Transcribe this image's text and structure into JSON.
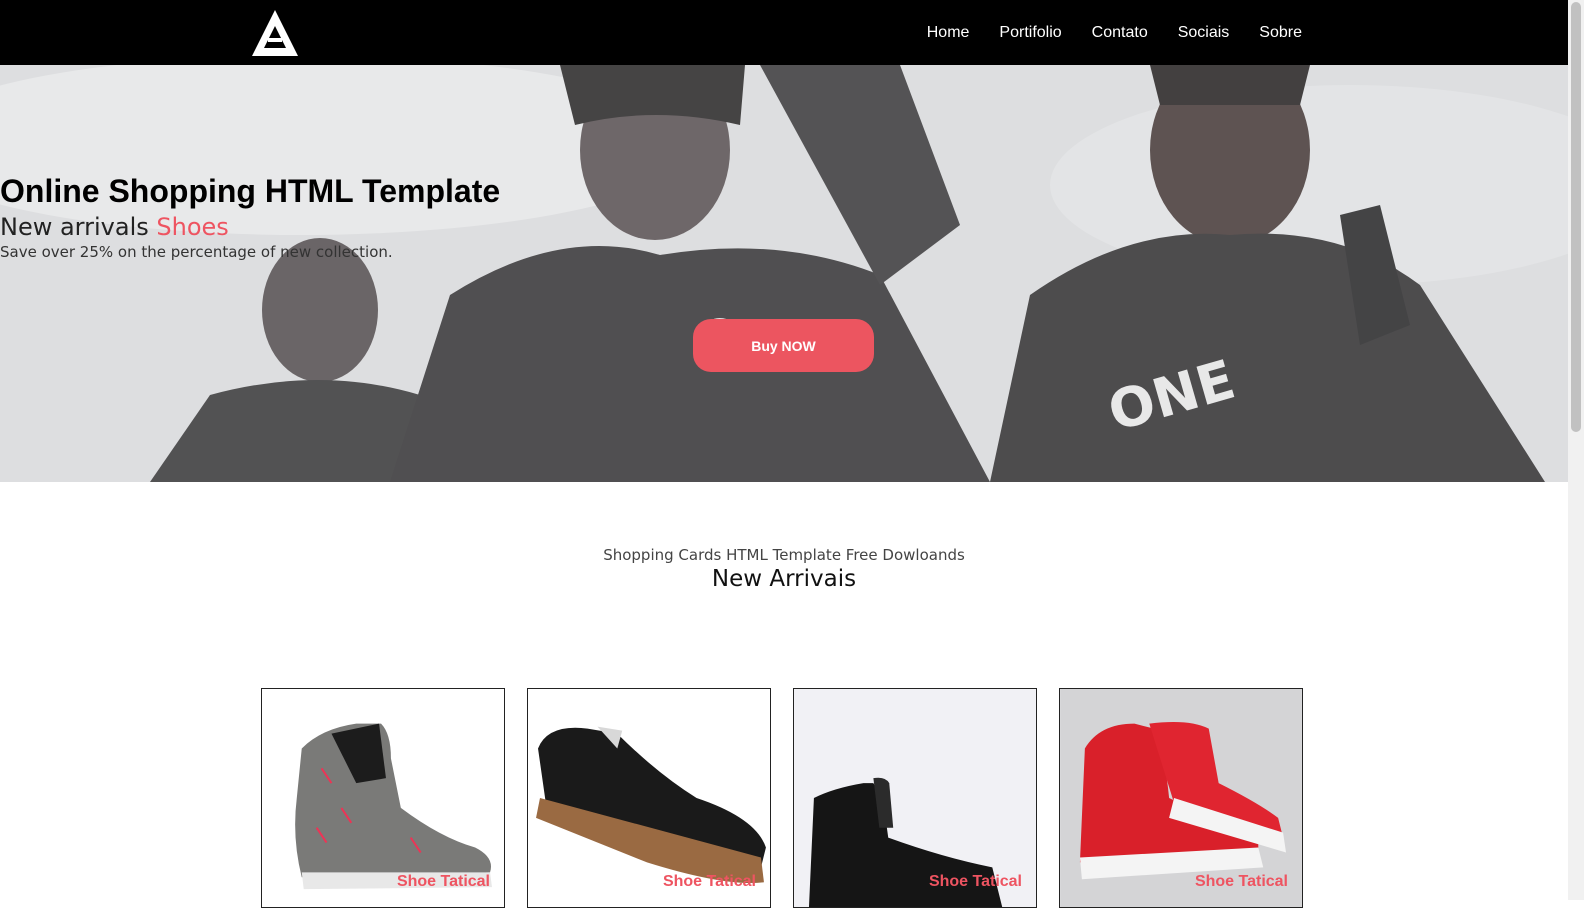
{
  "nav": {
    "logo": "triangle-logo",
    "items": [
      {
        "label": "Home"
      },
      {
        "label": "Portifolio"
      },
      {
        "label": "Contato"
      },
      {
        "label": "Sociais"
      },
      {
        "label": "Sobre"
      }
    ]
  },
  "hero": {
    "title": "Online Shopping HTML Template",
    "subtitle_prefix": "New arrivals",
    "subtitle_accent": "Shoes",
    "text": "Save over 25% on the percentage of new collection.",
    "button_label": "Buy NOW"
  },
  "arrivals": {
    "kicker": "Shopping Cards HTML Template Free Dowloands",
    "title": "New Arrivais",
    "cards": [
      {
        "label": "Shoe Tatical"
      },
      {
        "label": "Shoe Tatical"
      },
      {
        "label": "Shoe Tatical"
      },
      {
        "label": "Shoe Tatical"
      }
    ]
  },
  "colors": {
    "accent": "#ec5560",
    "navbar": "#000000"
  }
}
